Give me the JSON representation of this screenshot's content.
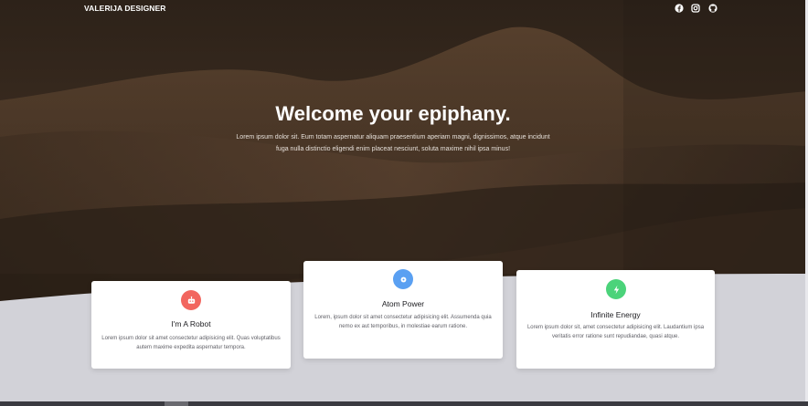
{
  "brand": "VALERIJA DESIGNER",
  "social_icons": [
    "facebook-icon",
    "instagram-icon",
    "github-icon"
  ],
  "hero": {
    "title": "Welcome your epiphany.",
    "lead": "Lorem ipsum dolor sit. Eum totam aspernatur aliquam praesentium aperiam magni, dignissimos, atque incidunt fuga nulla distinctio eligendi enim placeat nesciunt, soluta maxime nihil ipsa minus!"
  },
  "cards": [
    {
      "title": "I'm A Robot",
      "text": "Lorem ipsum dolor sit amet consectetur adipisicing elit. Quas voluptatibus autem maxime expedita aspernatur tempora.",
      "icon": "robot-icon",
      "color": "#f2665f"
    },
    {
      "title": "Atom Power",
      "text": "Lorem, ipsum dolor sit amet consectetur adipisicing elit. Assumenda quia nemo ex aut temporibus, in molestiae earum ratione.",
      "icon": "atom-icon",
      "color": "#5aa0f2"
    },
    {
      "title": "Infinite Energy",
      "text": "Lorem ipsum dolor sit, amet consectetur adipisicing elit. Laudantium ipsa veritatis error ratione sunt repudiandae, quasi atque.",
      "icon": "bolt-icon",
      "color": "#4bd37a"
    }
  ],
  "colors": {
    "hero_dark": "#2b2018",
    "section_bg": "#d2d2d8",
    "card_bg": "#ffffff"
  }
}
